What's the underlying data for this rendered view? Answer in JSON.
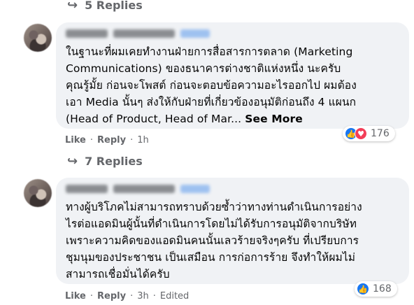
{
  "thread1": {
    "replies_label": "5 Replies"
  },
  "comment1": {
    "lines": [
      "ในฐานะที่ผมเคยทำงานฝ่ายการสื่อสารการตลาด (Marketing",
      "Communications) ของธนาคารต่างชาติแห่งหนึ่ง นะครับ",
      "คุณรู้มั้ย ก่อนจะโพสต์ ก่อนจะตอบข้อความอะไรออกไป ผมต้อง",
      "เอา Media นั้นๆ ส่งให้กับฝ่ายที่เกี่ยวข้องอนุมัติก่อนถึง 4 แผนก",
      "(Head of Product, Head of Mar..."
    ],
    "see_more": "See More",
    "reaction_count": "176",
    "like_label": "Like",
    "reply_label": "Reply",
    "time": "1h"
  },
  "thread2": {
    "replies_label": "7 Replies"
  },
  "comment2": {
    "lines": [
      "ทางผู้บริโภคไม่สามารถทราบด้วยซ้ำว่าทางท่านดำเนินการอย่าง",
      "ไรต่อแอดมินผู้นั้นที่ดำเนินการโดยไม่ได้รับการอนุมัติจากบริษัท",
      "เพราะความคิดของแอดมินคนนั้นเลวร้ายจริงๆครับ ที่เปรียบการ",
      "ชุมนุมของประชาชน เป็นเสมือน การก่อการร้าย จึงทำให้ผมไม่",
      "สามารถเชื่อมั่นได้ครับ"
    ],
    "reaction_count": "168",
    "like_label": "Like",
    "reply_label": "Reply",
    "time": "3h",
    "edited_label": "Edited"
  },
  "icons": {
    "reply_arrow": "reply-arrow-icon",
    "like": "like-icon",
    "love": "love-icon"
  },
  "colors": {
    "bubble": "#f0f2f5",
    "secondary_text": "#65676b",
    "like_blue": "#1877f2",
    "love_red": "#f33e58"
  }
}
